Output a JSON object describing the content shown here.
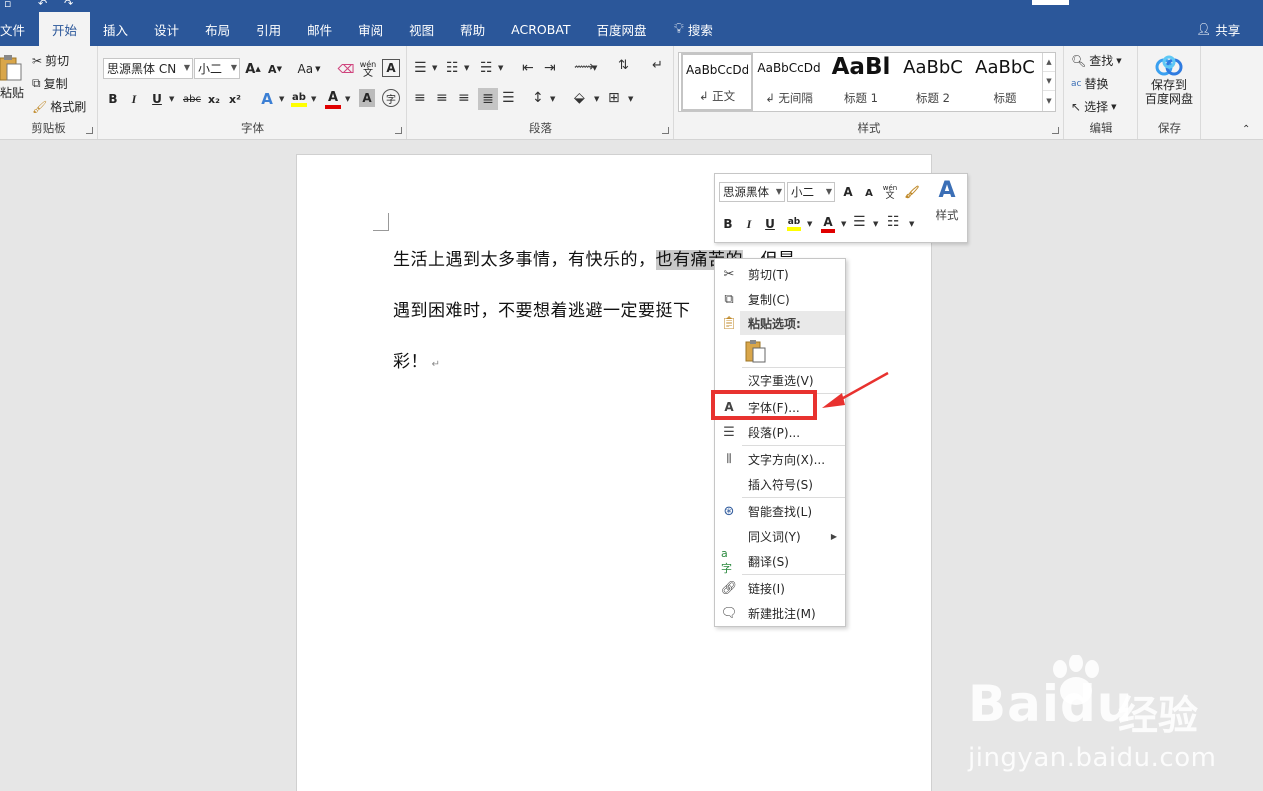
{
  "tabs": [
    {
      "label": "文件"
    },
    {
      "label": "开始"
    },
    {
      "label": "插入"
    },
    {
      "label": "设计"
    },
    {
      "label": "布局"
    },
    {
      "label": "引用"
    },
    {
      "label": "邮件"
    },
    {
      "label": "审阅"
    },
    {
      "label": "视图"
    },
    {
      "label": "帮助"
    },
    {
      "label": "ACROBAT"
    },
    {
      "label": "百度网盘"
    }
  ],
  "active_tab": "开始",
  "tell_me": "搜索",
  "share": "共享",
  "ribbon": {
    "clipboard": {
      "label": "剪贴板",
      "paste": "粘贴",
      "cut": "剪切",
      "copy": "复制",
      "format_painter": "格式刷"
    },
    "font": {
      "label": "字体",
      "font_name": "思源黑体 CN",
      "font_size": "小二",
      "grow": "A",
      "shrink": "A",
      "change_case": "Aa",
      "phonetic": "wén",
      "bold": "B",
      "italic": "I",
      "underline": "U",
      "strike": "abc",
      "subscript": "x₂",
      "superscript": "x²"
    },
    "paragraph": {
      "label": "段落"
    },
    "styles": {
      "label": "样式",
      "items": [
        {
          "sample": "AaBbCcDd",
          "name": "↲ 正文"
        },
        {
          "sample": "AaBbCcDd",
          "name": "↲ 无间隔"
        },
        {
          "sample": "AaBl",
          "name": "标题 1"
        },
        {
          "sample": "AaBbC",
          "name": "标题 2"
        },
        {
          "sample": "AaBbC",
          "name": "标题"
        }
      ]
    },
    "editing": {
      "label": "编辑",
      "find": "查找",
      "replace": "替换",
      "select": "选择"
    },
    "save": {
      "label": "保存",
      "button_line1": "保存到",
      "button_line2": "百度网盘"
    }
  },
  "document": {
    "line1_before": "生活上遇到太多事情，有快乐的，",
    "line1_selected": "也有痛苦的",
    "line1_after": "，但是",
    "line2": "遇到困难时，不要想着逃避一定要挺下",
    "line3": "彩！"
  },
  "minibar": {
    "font_name": "思源黑体",
    "font_size": "小二",
    "styles_label": "样式"
  },
  "context_menu": {
    "cut": "剪切(T)",
    "copy": "复制(C)",
    "paste_options": "粘贴选项:",
    "reconvert": "汉字重选(V)",
    "font": "字体(F)...",
    "paragraph": "段落(P)...",
    "text_direction": "文字方向(X)...",
    "insert_symbol": "插入符号(S)",
    "smart_lookup": "智能查找(L)",
    "synonyms": "同义词(Y)",
    "translate": "翻译(S)",
    "link": "链接(I)",
    "new_comment": "新建批注(M)"
  },
  "annotation": {
    "highlight_color": "#e8322f"
  },
  "watermark": {
    "brand": "Baidu",
    "brand_cn": "经验",
    "url": "jingyan.baidu.com"
  },
  "colors": {
    "accent": "#2b579a",
    "ribbon_bg": "#f3f3f3",
    "highlight_yellow": "#ffff00",
    "font_red": "#e00000"
  }
}
